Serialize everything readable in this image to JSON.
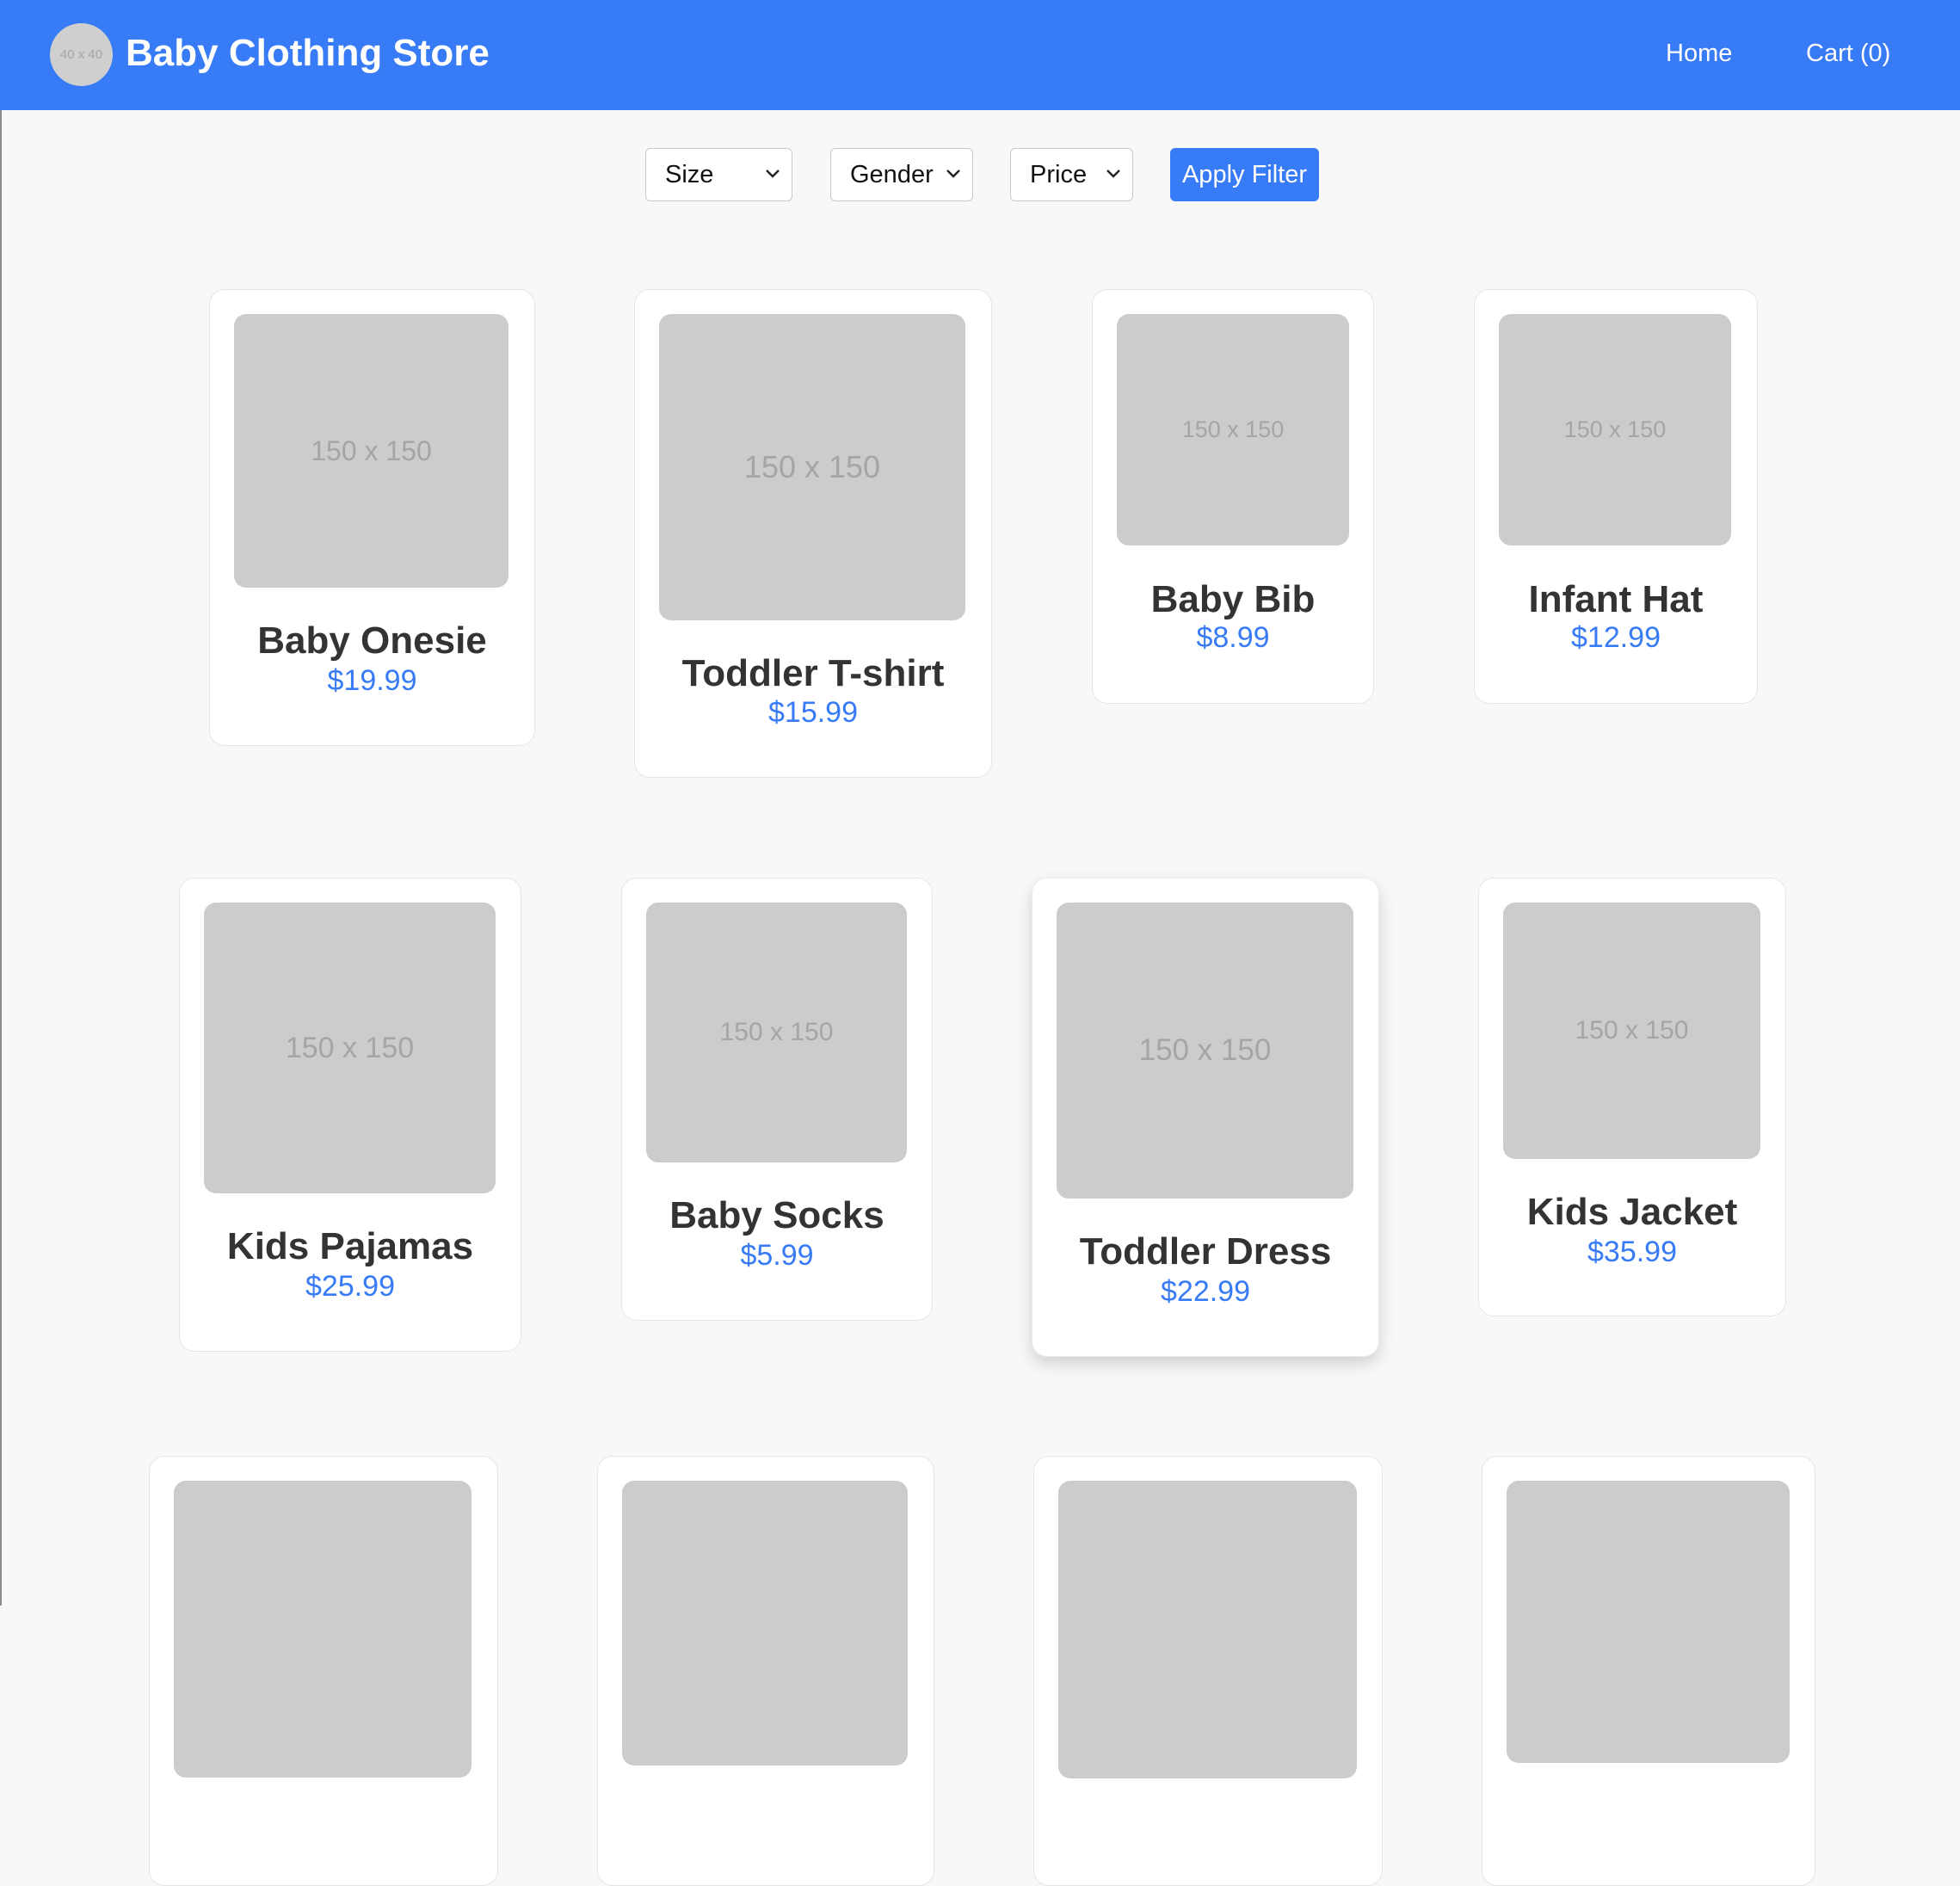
{
  "header": {
    "logo_text": "40 x 40",
    "title": "Baby Clothing Store",
    "nav": {
      "home": "Home",
      "cart": "Cart (0)"
    }
  },
  "filters": {
    "size": "Size",
    "gender": "Gender",
    "price": "Price",
    "apply": "Apply Filter"
  },
  "products": [
    {
      "name": "Baby Onesie",
      "price": "$19.99",
      "image_text": "150 x 150"
    },
    {
      "name": "Toddler T-shirt",
      "price": "$15.99",
      "image_text": "150 x 150"
    },
    {
      "name": "Baby Bib",
      "price": "$8.99",
      "image_text": "150 x 150"
    },
    {
      "name": "Infant Hat",
      "price": "$12.99",
      "image_text": "150 x 150"
    },
    {
      "name": "Kids Pajamas",
      "price": "$25.99",
      "image_text": "150 x 150"
    },
    {
      "name": "Baby Socks",
      "price": "$5.99",
      "image_text": "150 x 150"
    },
    {
      "name": "Toddler Dress",
      "price": "$22.99",
      "image_text": "150 x 150"
    },
    {
      "name": "Kids Jacket",
      "price": "$35.99",
      "image_text": "150 x 150"
    }
  ],
  "colors": {
    "header_bg": "#387bf6",
    "accent": "#387bf6",
    "placeholder": "#cccccc",
    "page_bg": "#f8f8f8"
  }
}
